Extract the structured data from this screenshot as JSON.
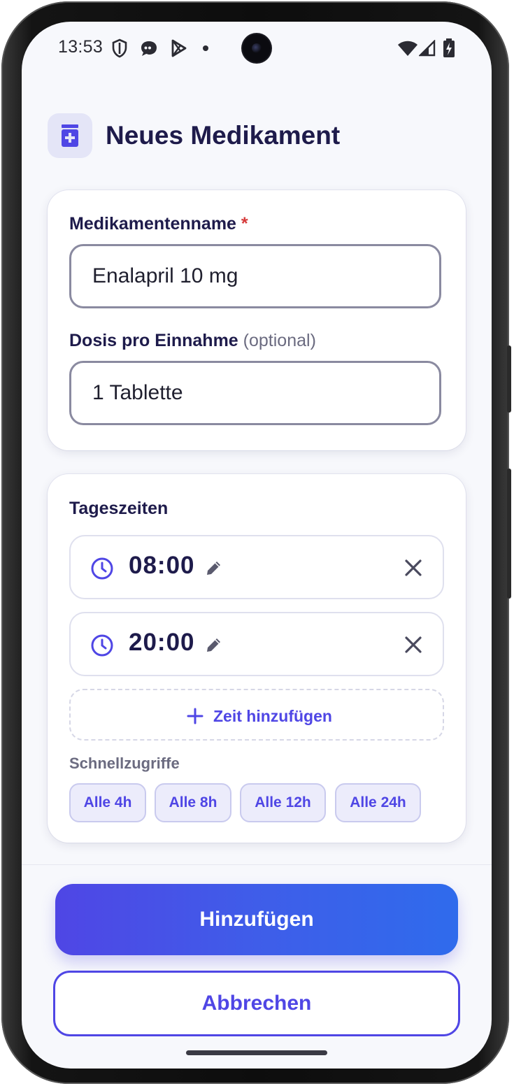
{
  "status_bar": {
    "time": "13:53",
    "left_icons": [
      "shield-icon",
      "chat-bubble-icon",
      "play-store-icon",
      "dot-icon"
    ],
    "right_icons": [
      "wifi-icon",
      "signal-icon",
      "battery-charging-icon"
    ]
  },
  "header": {
    "icon": "medicine-bottle-icon",
    "title": "Neues Medikament"
  },
  "form": {
    "name_label": "Medikamentenname",
    "required_mark": "*",
    "name_value": "Enalapril 10 mg",
    "dose_label": "Dosis pro Einnahme",
    "dose_optional": "(optional)",
    "dose_value": "1 Tablette"
  },
  "times": {
    "section_label": "Tageszeiten",
    "entries": [
      {
        "time": "08:00"
      },
      {
        "time": "20:00"
      }
    ],
    "add_label": "Zeit hinzufügen",
    "quick_label": "Schnellzugriffe",
    "quick_chips": [
      "Alle 4h",
      "Alle 8h",
      "Alle 12h",
      "Alle 24h"
    ]
  },
  "actions": {
    "submit_label": "Hinzufügen",
    "cancel_label": "Abbrechen"
  },
  "colors": {
    "accent": "#4f46e5",
    "accent_end": "#2f6bec",
    "title": "#1e1b4b",
    "required": "#d63b3b",
    "background": "#f7f8fc"
  }
}
